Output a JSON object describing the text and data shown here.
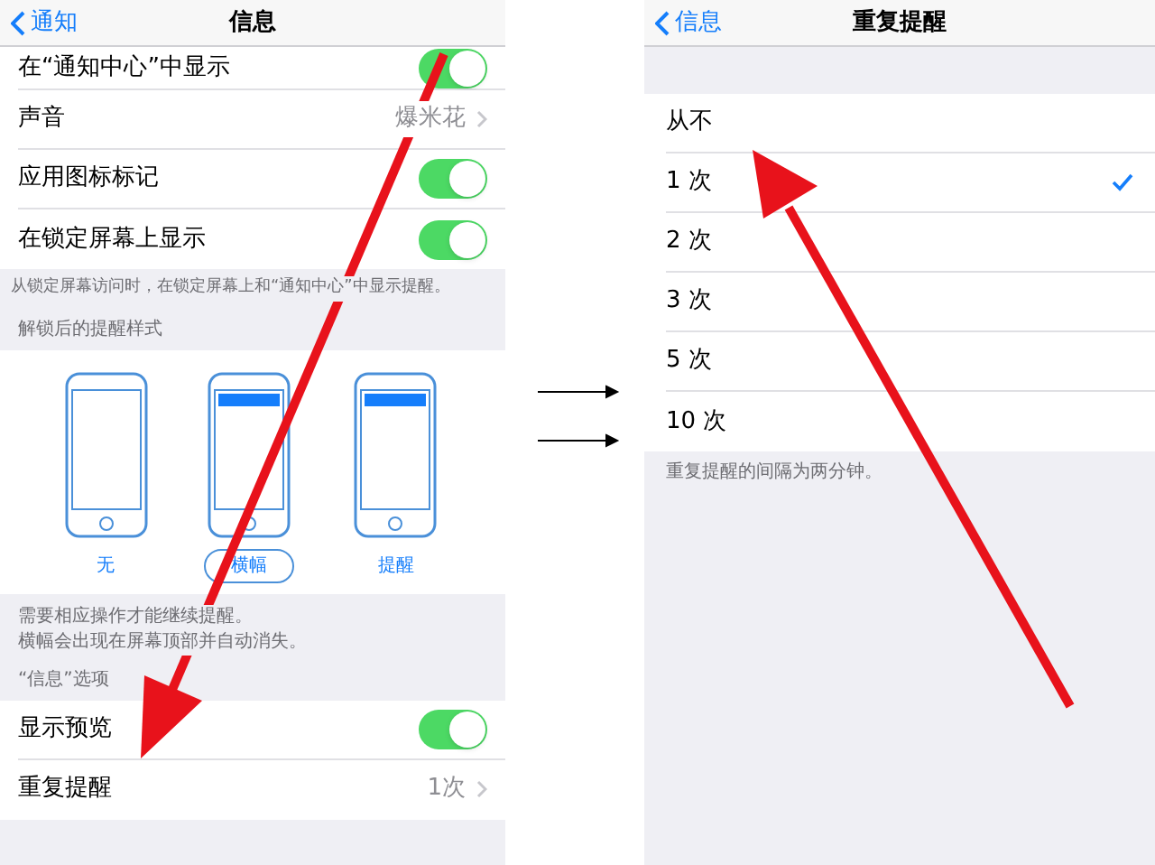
{
  "left_screen": {
    "back": "通知",
    "title": "信息",
    "rows": [
      {
        "kind": "toggle",
        "label": "在“通知中心”中显示",
        "on": true
      },
      {
        "kind": "value",
        "label": "声音",
        "value": "爆米花"
      },
      {
        "kind": "toggle",
        "label": "应用图标标记",
        "on": true
      },
      {
        "kind": "toggle",
        "label": "在锁定屏幕上显示",
        "on": true
      }
    ],
    "footer": "从锁定屏幕访问时，在锁定屏幕上和“通知中心”中显示提醒。",
    "styles_header": "解锁后的提醒样式",
    "styles": [
      {
        "label": "无",
        "banner": false,
        "selected": false
      },
      {
        "label": "横幅",
        "banner": true,
        "selected": true
      },
      {
        "label": "提醒",
        "banner": true,
        "selected": false
      }
    ],
    "styles_footer": [
      "需要相应操作才能继续提醒。",
      "横幅会出现在屏幕顶部并自动消失。"
    ],
    "options_header": "“信息”选项",
    "options": [
      {
        "kind": "toggle",
        "label": "显示预览",
        "on": true
      },
      {
        "kind": "value",
        "label": "重复提醒",
        "value": "1次"
      }
    ]
  },
  "right_screen": {
    "back": "信息",
    "title": "重复提醒",
    "choices": [
      {
        "label": "从不",
        "selected": false
      },
      {
        "label": "1 次",
        "selected": true
      },
      {
        "label": "2 次",
        "selected": false
      },
      {
        "label": "3 次",
        "selected": false
      },
      {
        "label": "5 次",
        "selected": false
      },
      {
        "label": "10 次",
        "selected": false
      }
    ],
    "footer": "重复提醒的间隔为两分钟。"
  }
}
